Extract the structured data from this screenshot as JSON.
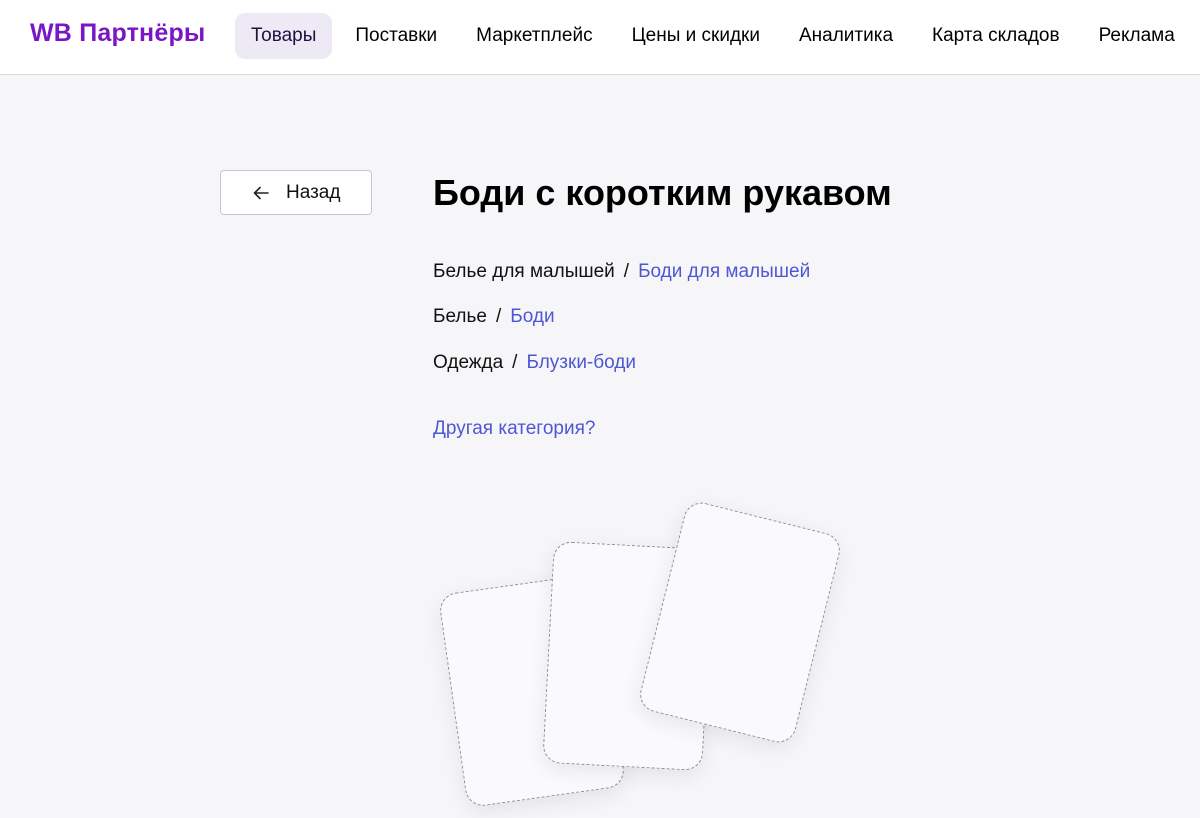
{
  "header": {
    "logo": "WB Партнёры",
    "nav": [
      {
        "label": "Товары",
        "active": true
      },
      {
        "label": "Поставки",
        "active": false
      },
      {
        "label": "Маркетплейс",
        "active": false
      },
      {
        "label": "Цены и скидки",
        "active": false
      },
      {
        "label": "Аналитика",
        "active": false
      },
      {
        "label": "Карта складов",
        "active": false
      },
      {
        "label": "Реклама",
        "active": false
      }
    ]
  },
  "back_button": {
    "label": "Назад",
    "icon": "arrow-left-icon"
  },
  "product": {
    "title": "Боди с коротким рукавом",
    "categories": [
      {
        "parent": "Белье для малышей",
        "separator": "/",
        "sub": "Боди для малышей"
      },
      {
        "parent": "Белье",
        "separator": "/",
        "sub": "Боди"
      },
      {
        "parent": "Одежда",
        "separator": "/",
        "sub": "Блузки-боди"
      }
    ],
    "other_category_link": "Другая категория?"
  },
  "colors": {
    "brand": "#7b16c7",
    "link": "#4d57d3",
    "nav_active_bg": "#ede9f5",
    "page_bg": "#f6f6f9"
  }
}
